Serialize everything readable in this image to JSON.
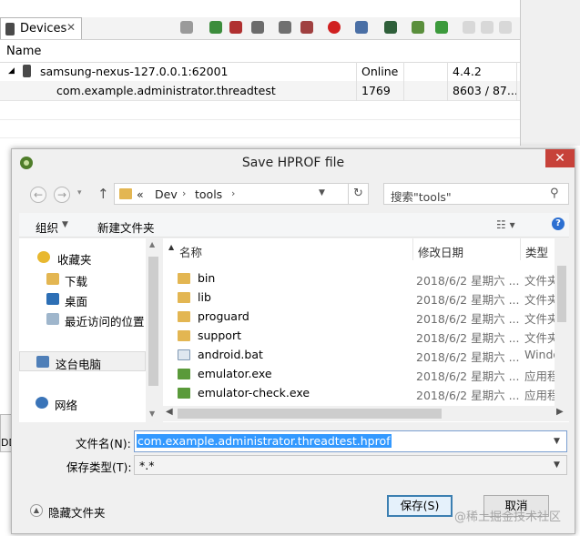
{
  "devices_view": {
    "tab_label": "Devices",
    "tab_close": "✕",
    "column_header": "Name",
    "device_row": {
      "name": "samsung-nexus-127.0.0.1:62001",
      "status": "Online",
      "version": "4.4.2"
    },
    "process_row": {
      "name": "com.example.administrator.threadtest",
      "pid": "1769",
      "port": "8603 / 87..."
    },
    "side_fragment": "DD"
  },
  "dialog": {
    "title": "Save HPROF file",
    "close_glyph": "✕",
    "nav": {
      "back": "←",
      "forward": "→",
      "up": "↑",
      "recent": "▾"
    },
    "address": {
      "breadcrumbs": [
        "«",
        "Dev",
        "tools"
      ],
      "separator": "›"
    },
    "search_placeholder": "搜索\"tools\"",
    "commands": {
      "organize": "组织",
      "new_folder": "新建文件夹"
    },
    "nav_pane": [
      {
        "label": "收藏夹",
        "icon": "star-icon"
      },
      {
        "label": "下载",
        "icon": "download-folder-icon"
      },
      {
        "label": "桌面",
        "icon": "desktop-icon"
      },
      {
        "label": "最近访问的位置",
        "icon": "recent-places-icon"
      },
      {
        "label": "这台电脑",
        "icon": "computer-icon"
      },
      {
        "label": "网络",
        "icon": "network-icon"
      }
    ],
    "columns": {
      "name": "名称",
      "date": "修改日期",
      "type": "类型"
    },
    "files": [
      {
        "name": "bin",
        "date": "2018/6/2 星期六 ...",
        "type": "文件夹",
        "icon": "folder-icon"
      },
      {
        "name": "lib",
        "date": "2018/6/2 星期六 ...",
        "type": "文件夹",
        "icon": "folder-icon"
      },
      {
        "name": "proguard",
        "date": "2018/6/2 星期六 ...",
        "type": "文件夹",
        "icon": "folder-icon"
      },
      {
        "name": "support",
        "date": "2018/6/2 星期六 ...",
        "type": "文件夹",
        "icon": "folder-icon"
      },
      {
        "name": "android.bat",
        "date": "2018/6/2 星期六 ...",
        "type": "Windo",
        "icon": "batch-file-icon"
      },
      {
        "name": "emulator.exe",
        "date": "2018/6/2 星期六 ...",
        "type": "应用程",
        "icon": "exe-icon"
      },
      {
        "name": "emulator-check.exe",
        "date": "2018/6/2 星期六 ...",
        "type": "应用程",
        "icon": "exe-icon"
      }
    ],
    "filename_label": "文件名(N):",
    "filename_value": "com.example.administrator.threadtest.hprof",
    "filetype_label": "保存类型(T):",
    "filetype_value": "*.*",
    "hide_folders": "隐藏文件夹",
    "save_button": "保存(S)",
    "cancel_button": "取消",
    "watermark": "@稀土掘金技术社区"
  },
  "colors": {
    "selection": "#3399ff",
    "folder": "#e3b652",
    "close": "#c7423a",
    "accent": "#3c7fb1"
  }
}
